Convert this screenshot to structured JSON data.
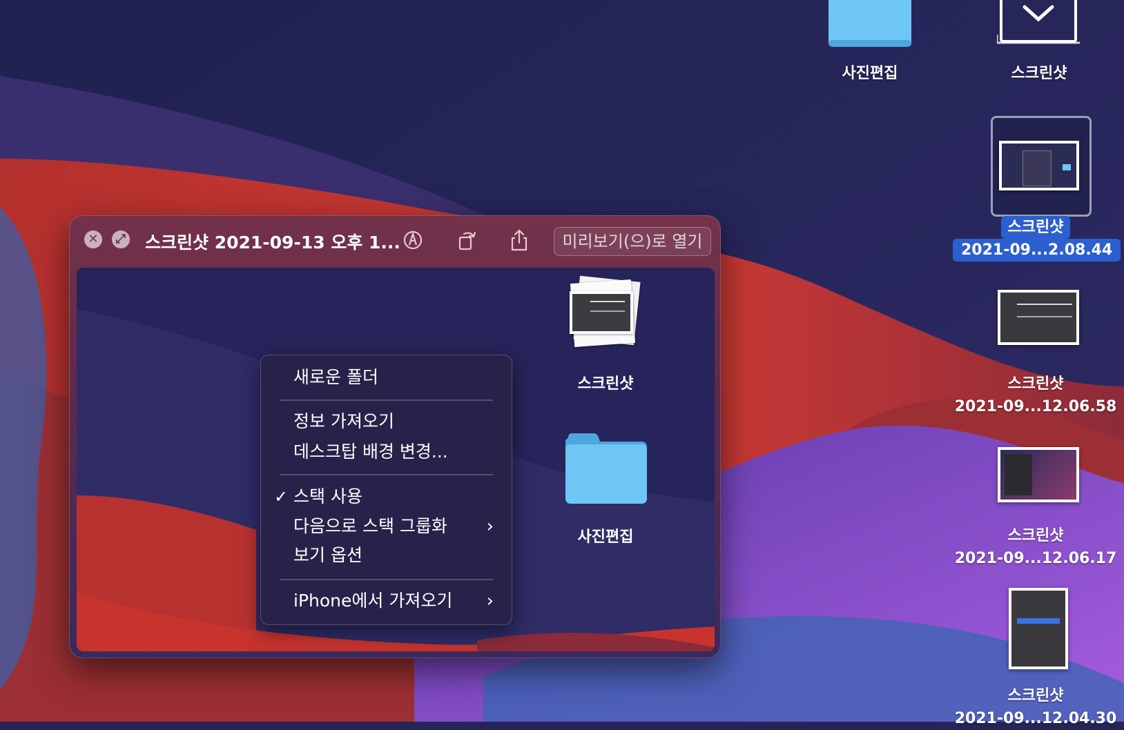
{
  "desktop": {
    "icons": [
      {
        "label": "사진편집"
      },
      {
        "label": "스크린샷"
      },
      {
        "label_line1": "스크린샷",
        "label_line2": "2021-09...2.08.44"
      },
      {
        "label_line1": "스크린샷",
        "label_line2": "2021-09...12.06.58"
      },
      {
        "label_line1": "스크린샷",
        "label_line2": "2021-09...12.06.17"
      },
      {
        "label_line1": "스크린샷",
        "label_line2": "2021-09...12.04.30"
      }
    ]
  },
  "quicklook": {
    "title": "스크린샷 2021-09-13 오후 1...",
    "open_with_label": "미리보기(으)로 열기",
    "icons": {
      "close": "close-icon",
      "fullscreen": "fullscreen-icon",
      "markup": "markup-icon",
      "rotate": "rotate-icon",
      "share": "share-icon"
    },
    "content": {
      "stack_label": "스크린샷",
      "folder_label": "사진편집"
    },
    "context_menu": {
      "items": [
        {
          "label": "새로운 폴더"
        },
        {
          "label": "정보 가져오기"
        },
        {
          "label": "데스크탑 배경 변경..."
        },
        {
          "label": "스택 사용",
          "checked": true
        },
        {
          "label": "다음으로 스택 그룹화",
          "submenu": true
        },
        {
          "label": "보기 옵션"
        },
        {
          "label": "iPhone에서 가져오기",
          "submenu": true
        }
      ],
      "check_glyph": "✓",
      "chevron_glyph": "›"
    }
  },
  "colors": {
    "selection": "#2c5fd0",
    "folder": "#6ec6f5",
    "wallpaper_navy": "#272457",
    "wallpaper_red": "#c8332e",
    "wallpaper_purple": "#8b55d6"
  }
}
